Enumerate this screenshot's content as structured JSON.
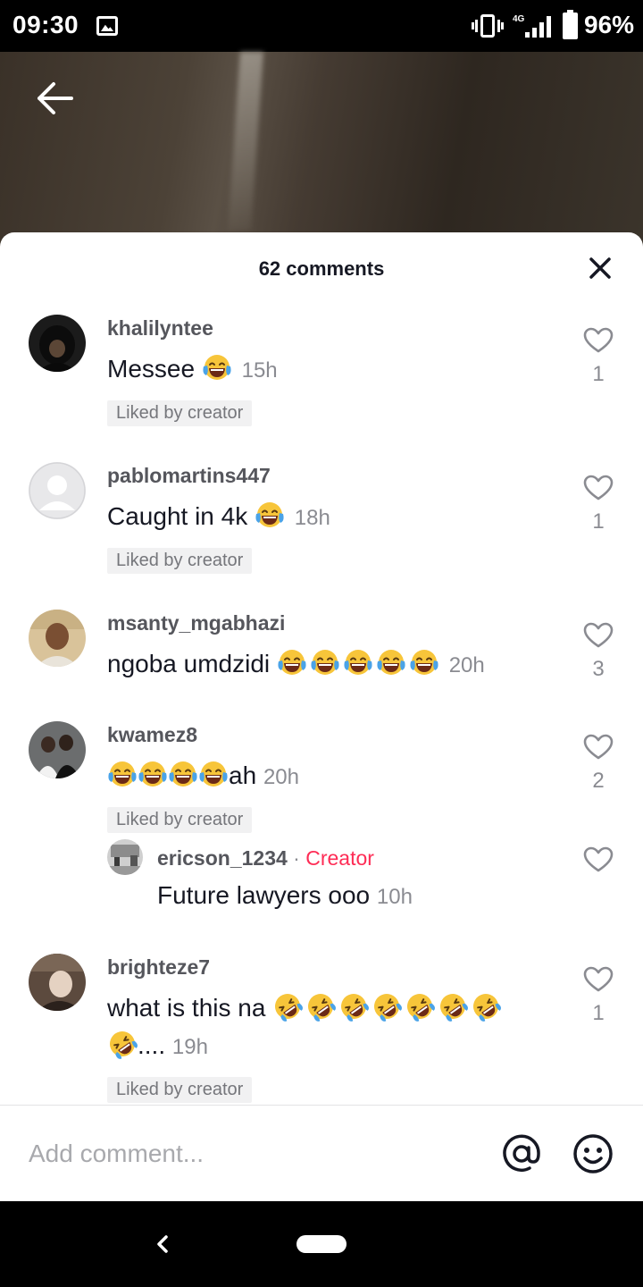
{
  "status_bar": {
    "time": "09:30",
    "network": "4G",
    "battery": "96%",
    "icons": [
      "gallery-icon",
      "vibrate-icon",
      "signal-icon",
      "battery-icon"
    ]
  },
  "header": {
    "back_icon": "arrow-left-icon",
    "title": "62 comments",
    "close_icon": "close-icon"
  },
  "comments": [
    {
      "username": "khalilyntee",
      "text": "Messee",
      "emojis": [
        "tears-of-joy"
      ],
      "time": "15h",
      "badge": "Liked by creator",
      "likes": "1"
    },
    {
      "username": "pablomartins447",
      "text": "Caught in 4k",
      "emojis": [
        "tears-of-joy"
      ],
      "time": "18h",
      "badge": "Liked by creator",
      "likes": "1"
    },
    {
      "username": "msanty_mgabhazi",
      "text": "ngoba umdzidi",
      "emojis": [
        "tears-of-joy",
        "tears-of-joy",
        "tears-of-joy",
        "tears-of-joy",
        "tears-of-joy"
      ],
      "time": "20h",
      "likes": "3"
    },
    {
      "username": "kwamez8",
      "text": "ah",
      "emojis": [
        "tears-of-joy",
        "tears-of-joy",
        "tears-of-joy",
        "tears-of-joy"
      ],
      "time": "20h",
      "badge": "Liked by creator",
      "likes": "2",
      "reply": {
        "username": "ericson_1234",
        "separator": "·",
        "tag": "Creator",
        "text": "Future lawyers ooo",
        "time": "10h"
      }
    },
    {
      "username": "brighteze7",
      "text": "what is this na",
      "emojis": [
        "rolling-on-floor-laughing",
        "rolling-on-floor-laughing",
        "rolling-on-floor-laughing",
        "rolling-on-floor-laughing",
        "rolling-on-floor-laughing",
        "rolling-on-floor-laughing",
        "rolling-on-floor-laughing"
      ],
      "tail_emojis": [
        "rolling-on-floor-laughing"
      ],
      "tail_text": "....",
      "time": "19h",
      "badge": "Liked by creator",
      "likes": "1"
    }
  ],
  "composer": {
    "placeholder": "Add comment...",
    "mention_icon": "at-sign-icon",
    "emoji_icon": "smiley-icon"
  },
  "nav": {
    "back_icon": "nav-back-icon",
    "home_icon": "home-pill-icon"
  },
  "colors": {
    "creator_accent": "#fe2c55",
    "text_primary": "#161823",
    "text_secondary": "#8a8b91"
  }
}
